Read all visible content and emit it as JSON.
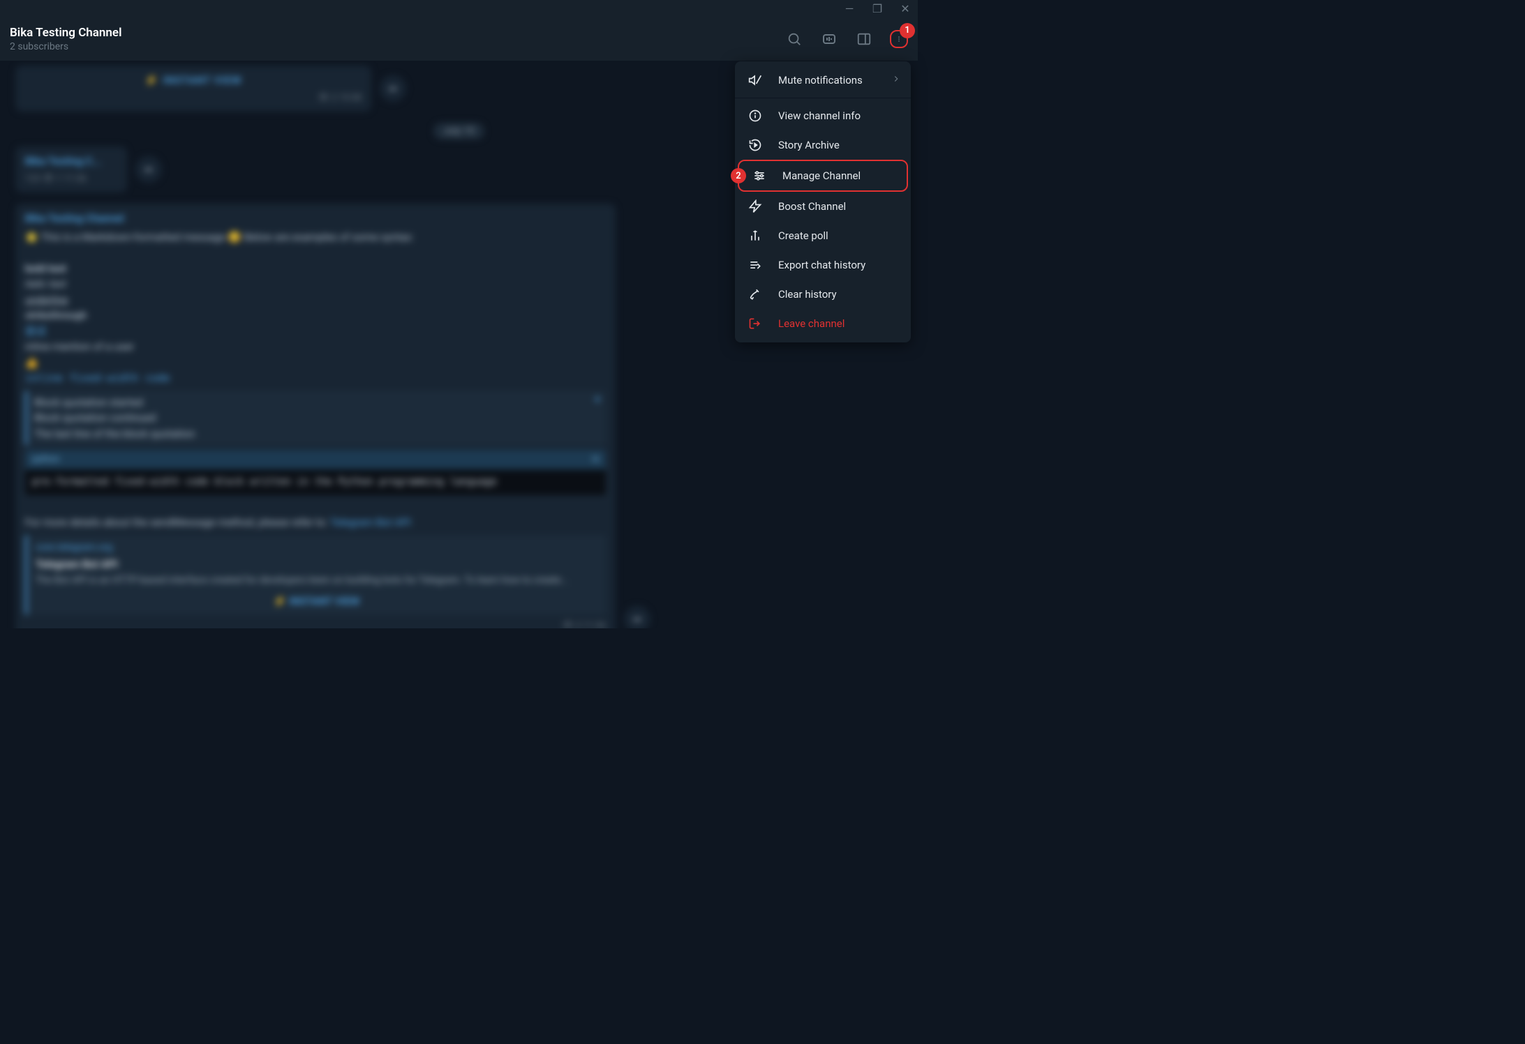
{
  "window": {
    "minimize": "—",
    "maximize": "❐",
    "close": "✕"
  },
  "header": {
    "title": "Bika Testing Channel",
    "subscribers": "2 subscribers"
  },
  "annotations": {
    "badge1": "1",
    "badge2": "2"
  },
  "content": {
    "instant_view": "INSTANT VIEW",
    "views1": "2  15:58",
    "date": "July 10",
    "small_channel": "Bika Testing C...",
    "small_meta": "123 👁 1  11:36",
    "channel": "Bika Testing Channel",
    "intro": "⭐ This is a Markdown-formatted message 😊  Below are examples of some syntax:",
    "bold": "bold text",
    "italic": "italic text",
    "underline": "underline",
    "strike": "strikethrough",
    "link": "尝试",
    "mention": "inline mention of a user",
    "emoji": "👍",
    "inline_code": "inline fixed-width code",
    "quote1": "Block quotation started",
    "quote2": "Block quotation continued",
    "quote3": "The last line of the block quotation",
    "lang": "python",
    "code": "pre-formatted fixed-width code block written in the Python programming language",
    "details": "For more details about the sendMessage method, please refer to: ",
    "details_link": "Telegram Bot API",
    "card_site": "core.telegram.org",
    "card_title": "Telegram Bot API",
    "card_desc": "The Bot API is an HTTP-based interface created for developers keen on building bots for Telegram. To learn how to create...",
    "iv2": "⚡ INSTANT VIEW",
    "views2": "👁 2  11:36"
  },
  "menu": {
    "mute": "Mute notifications",
    "info": "View channel info",
    "story": "Story Archive",
    "manage": "Manage Channel",
    "boost": "Boost Channel",
    "poll": "Create poll",
    "export": "Export chat history",
    "clear": "Clear history",
    "leave": "Leave channel"
  }
}
